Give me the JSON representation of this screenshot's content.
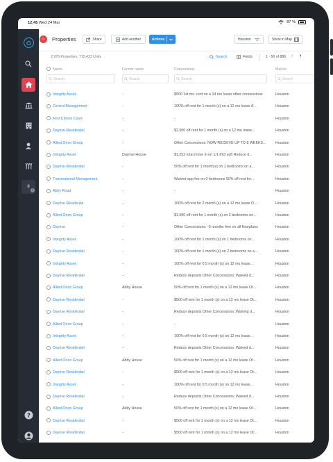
{
  "status_bar": {
    "time": "12:45",
    "date": "Wed 24 Mar",
    "battery": "87 %"
  },
  "header": {
    "app_badge": "☺",
    "title": "Properties",
    "share_label": "Share",
    "add_another_label": "Add another",
    "actions_label": "Actions",
    "market_select": "Houston",
    "show_in_map_label": "Show in Map"
  },
  "subbar": {
    "count_text": "2,976 Properties, 715,433 Units",
    "search_label": "Search",
    "fields_label": "Fields",
    "range_text": "1 - 50 of 886"
  },
  "table": {
    "columns": [
      "Name",
      "Former name",
      "Concessions",
      "Market"
    ],
    "filter_placeholder": "Search",
    "rows": [
      {
        "name": "Integrity Asset",
        "former": "-",
        "conc": "$500 1st mo. rent on a 14 mo lease other concessions",
        "market": "Houston"
      },
      {
        "name": "Central Management",
        "former": "-",
        "conc": "100% off rent for 1 month (s) on a 12 mo lease A...",
        "market": "Houston"
      },
      {
        "name": "First Choice Court",
        "former": "-",
        "conc": "-",
        "market": "Houston"
      },
      {
        "name": "Dayrise Residential",
        "former": "-",
        "conc": "$2,500 off rent for 1 month (s) on a 12 mo lease...",
        "market": "Houston"
      },
      {
        "name": "Allied Orion Group",
        "former": "-",
        "conc": "Other Concessions: NOW RECEIVE UP TO 8 WEEKS FREE",
        "market": "Houston"
      },
      {
        "name": "Integrity Asset",
        "former": "Dayrise House",
        "conc": "$1,252 total move in on 1/1 693 sqft Reduce d...",
        "market": "Houston"
      },
      {
        "name": "Dayrise Residential",
        "former": "-",
        "conc": "50% off rent for 1 month(s) on 1 bedrooms on a...",
        "market": "Houston"
      },
      {
        "name": "Transnational Management",
        "former": "-",
        "conc": "Waived app fee on 0 bedrooms 50% off rent for...",
        "market": "Houston"
      },
      {
        "name": "Abby Road",
        "former": "-",
        "conc": "-",
        "market": "Houston"
      },
      {
        "name": "Dayrise Residentia",
        "former": "-",
        "conc": "100% off rent for 2 month (s) on a 12 mo lease O...",
        "market": "Houston"
      },
      {
        "name": "Allied Orion Group",
        "former": "-",
        "conc": "$1,500 off rent for 1 month (s) on 2 bedrooms on...",
        "market": "Houston"
      },
      {
        "name": "Dayrise",
        "former": "-",
        "conc": "Other Concessions: -3 months free on all floorplans",
        "market": "Houston"
      },
      {
        "name": "Integrity Asset",
        "former": "-",
        "conc": "100% off rent for 1 month (s) on 1 bedrooms on...",
        "market": "Houston"
      },
      {
        "name": "Dayrise Residential",
        "former": "-",
        "conc": "100% off rent for 1 month (s) on 2 bedrooms on a...",
        "market": "Houston"
      },
      {
        "name": "Integrity Asset",
        "former": "-",
        "conc": "100% off rent for 0.5 month (s) on 12 mo lease...",
        "market": "Houston"
      },
      {
        "name": "Dayrise Residential",
        "former": "-",
        "conc": "Reduce deposits Other Concessions: Waived d...",
        "market": "Houston"
      },
      {
        "name": "Allied Orion Group",
        "former": "Abby House",
        "conc": "50% off rent for 1 month (s) on a 12 mo lease Ot...",
        "market": "Houston"
      },
      {
        "name": "Dayrise Residential",
        "former": "-",
        "conc": "$500 off rent for 1 month (s) on a 12 mo lease Ot...",
        "market": "Houston"
      },
      {
        "name": "Dayrise Residential",
        "former": "-",
        "conc": "Reduce deposits Other Concessions: Waiving d...",
        "market": "Houston"
      },
      {
        "name": "Allied Orion Group",
        "former": "-",
        "conc": "-",
        "market": "Houston"
      },
      {
        "name": "Integrity Asset",
        "former": "-",
        "conc": "100% off rent for 0.5 month (s) on 12 mo lease...",
        "market": "Houston"
      },
      {
        "name": "Dayrise Residential",
        "former": "-",
        "conc": "Reduce deposits Other Concessions: Waived d...",
        "market": "Houston"
      },
      {
        "name": "Allied Orion Group",
        "former": "Abby House",
        "conc": "50% off rent for 1 month (s) on a 12 mo lease Ot...",
        "market": "Houston"
      },
      {
        "name": "Dayrise Residential",
        "former": "-",
        "conc": "$500 off rent for 1 month (s) on a 12 mo lease Ot...",
        "market": "Houston"
      },
      {
        "name": "Integrity Asset",
        "former": "-",
        "conc": "100% off rent for 0.5 month (s) on 12 mo lease...",
        "market": "Houston"
      },
      {
        "name": "Dayrise Residential",
        "former": "-",
        "conc": "Reduce deposits Other Concessions: Waived d...",
        "market": "Houston"
      },
      {
        "name": "Allied Orion Group",
        "former": "Abby House",
        "conc": "50% off rent for 1 month (s) on a 12 mo lease Ot...",
        "market": "Houston"
      },
      {
        "name": "Dayrise Residential",
        "former": "-",
        "conc": "$500 off rent for 1 month (s) on a 12 mo lease Ot...",
        "market": "Houston"
      },
      {
        "name": "Dayrise Residential",
        "former": "-",
        "conc": "$500 off rent for 1 month (s) on a 12 mo lease Ot...",
        "market": "Houston"
      }
    ]
  },
  "sidebar": {
    "notification_count": "0"
  },
  "colors": {
    "accent": "#2f8ee5",
    "brand_red": "#e2434f",
    "sidebar_bg": "#262c36"
  }
}
